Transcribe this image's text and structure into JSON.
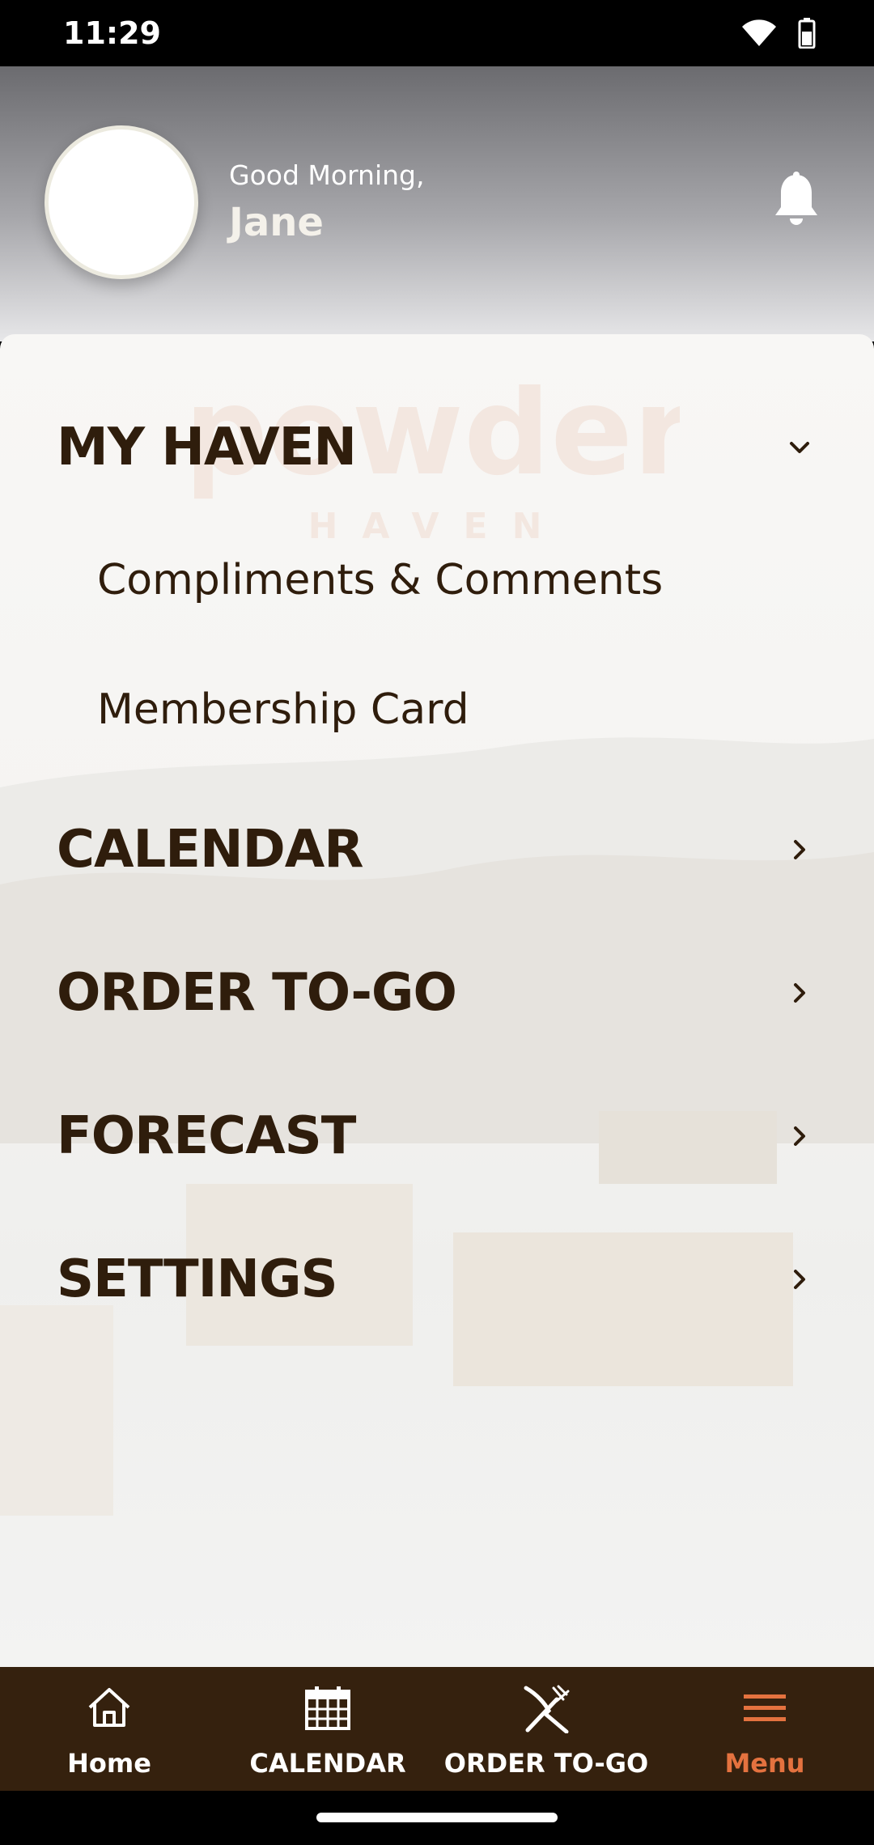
{
  "status_bar": {
    "time": "11:29",
    "icons": [
      "wifi-icon",
      "battery-icon"
    ]
  },
  "header": {
    "greeting": "Good Morning,",
    "user_name": "Jane",
    "icons": [
      "bell-icon"
    ]
  },
  "logo": {
    "word": "powder",
    "sub": "HAVEN"
  },
  "menu": {
    "my_haven": {
      "label": "MY HAVEN",
      "expanded": true,
      "items": [
        {
          "label": "Compliments & Comments"
        },
        {
          "label": "Membership Card"
        }
      ]
    },
    "calendar": {
      "label": "CALENDAR"
    },
    "order_to_go": {
      "label": "ORDER TO-GO"
    },
    "forecast": {
      "label": "FORECAST"
    },
    "settings": {
      "label": "SETTINGS"
    }
  },
  "bottom_nav": {
    "items": [
      {
        "label": "Home",
        "icon": "home-icon",
        "active": false
      },
      {
        "label": "CALENDAR",
        "icon": "calendar-icon",
        "active": false
      },
      {
        "label": "ORDER TO-GO",
        "icon": "fork-knife-icon",
        "active": false
      },
      {
        "label": "Menu",
        "icon": "hamburger-menu-icon",
        "active": true
      }
    ]
  },
  "colors": {
    "brand_dark": "#35210e",
    "text_dark": "#2f1d0c",
    "accent": "#e4723f"
  }
}
